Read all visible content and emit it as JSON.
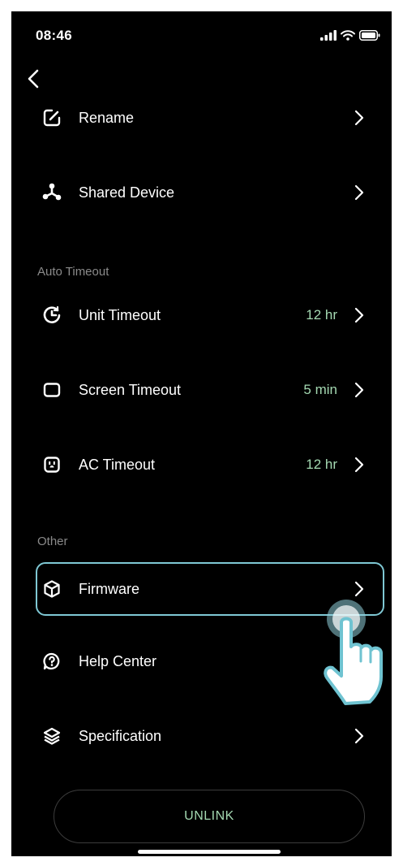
{
  "status_bar": {
    "time": "08:46"
  },
  "menu": {
    "rename": {
      "label": "Rename",
      "icon": "edit-icon"
    },
    "shared_device": {
      "label": "Shared Device",
      "icon": "share-icon"
    }
  },
  "auto_timeout": {
    "title": "Auto Timeout",
    "items": [
      {
        "label": "Unit Timeout",
        "value": "12 hr",
        "icon": "timer-icon"
      },
      {
        "label": "Screen Timeout",
        "value": "5 min",
        "icon": "screen-icon"
      },
      {
        "label": "AC Timeout",
        "value": "12 hr",
        "icon": "ac-outlet-icon"
      }
    ]
  },
  "other": {
    "title": "Other",
    "items": [
      {
        "label": "Firmware",
        "icon": "cube-icon"
      },
      {
        "label": "Help Center",
        "icon": "help-icon"
      },
      {
        "label": "Specification",
        "icon": "layers-icon"
      }
    ]
  },
  "unlink_label": "UNLINK",
  "colors": {
    "background": "#000000",
    "accent": "#a4d9b2",
    "highlight": "#7fc8d4",
    "muted": "#8a8a8a"
  }
}
